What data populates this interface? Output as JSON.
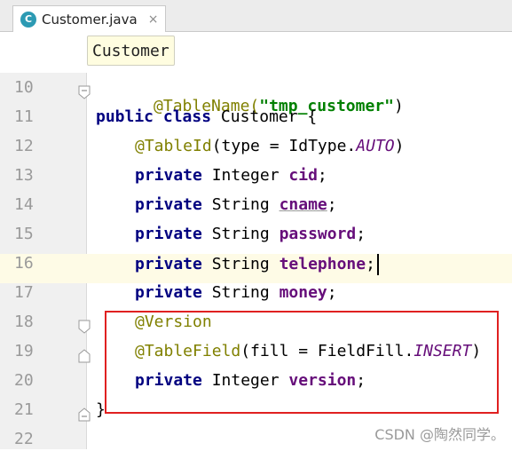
{
  "tab": {
    "icon_letter": "C",
    "filename": "Customer.java",
    "close_glyph": "×"
  },
  "breadcrumb": {
    "label": "Customer"
  },
  "code_lines": [
    {
      "num": "10",
      "parts": [
        {
          "t": "@TableName(",
          "c": "ann"
        },
        {
          "t": "\"tmp_customer\"",
          "c": "str"
        },
        {
          "t": ")",
          "c": ""
        }
      ]
    },
    {
      "num": "11",
      "parts": [
        {
          "t": "public class ",
          "c": "kw"
        },
        {
          "t": "Customer {",
          "c": ""
        }
      ]
    },
    {
      "num": "12",
      "parts": [
        {
          "t": "@TableId",
          "c": "ann"
        },
        {
          "t": "(type = IdType.",
          "c": ""
        },
        {
          "t": "AUTO",
          "c": "ital"
        },
        {
          "t": ")",
          "c": ""
        }
      ]
    },
    {
      "num": "13",
      "parts": [
        {
          "t": "private ",
          "c": "kw"
        },
        {
          "t": "Integer ",
          "c": ""
        },
        {
          "t": "cid",
          "c": "field"
        },
        {
          "t": ";",
          "c": ""
        }
      ]
    },
    {
      "num": "14",
      "parts": [
        {
          "t": "private ",
          "c": "kw"
        },
        {
          "t": "String ",
          "c": ""
        },
        {
          "t": "cname",
          "c": "field underline"
        },
        {
          "t": ";",
          "c": ""
        }
      ]
    },
    {
      "num": "15",
      "parts": [
        {
          "t": "private ",
          "c": "kw"
        },
        {
          "t": "String ",
          "c": ""
        },
        {
          "t": "password",
          "c": "field"
        },
        {
          "t": ";",
          "c": ""
        }
      ]
    },
    {
      "num": "16",
      "parts": [
        {
          "t": "private ",
          "c": "kw"
        },
        {
          "t": "String ",
          "c": ""
        },
        {
          "t": "telephone",
          "c": "field"
        },
        {
          "t": ";",
          "c": ""
        }
      ]
    },
    {
      "num": "17",
      "parts": [
        {
          "t": "private ",
          "c": "kw"
        },
        {
          "t": "String ",
          "c": ""
        },
        {
          "t": "money",
          "c": "field"
        },
        {
          "t": ";",
          "c": ""
        }
      ]
    },
    {
      "num": "18",
      "parts": [
        {
          "t": "@Version",
          "c": "ann"
        }
      ]
    },
    {
      "num": "19",
      "parts": [
        {
          "t": "@TableField",
          "c": "ann"
        },
        {
          "t": "(fill = FieldFill.",
          "c": ""
        },
        {
          "t": "INSERT",
          "c": "ital"
        },
        {
          "t": ")",
          "c": ""
        }
      ]
    },
    {
      "num": "20",
      "parts": [
        {
          "t": "private ",
          "c": "kw"
        },
        {
          "t": "Integer ",
          "c": ""
        },
        {
          "t": "version",
          "c": "field"
        },
        {
          "t": ";",
          "c": ""
        }
      ]
    },
    {
      "num": "21",
      "parts": [
        {
          "t": "}",
          "c": ""
        }
      ]
    },
    {
      "num": "22",
      "parts": []
    }
  ],
  "watermark": "CSDN @陶然同学。",
  "colors": {
    "highlight_box": "#e02020",
    "current_line": "#fefbe6"
  }
}
